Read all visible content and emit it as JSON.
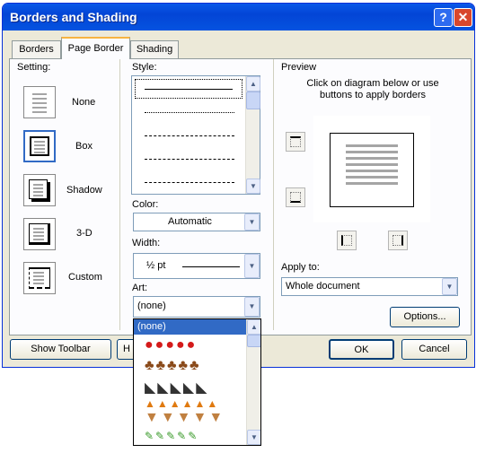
{
  "window": {
    "title": "Borders and Shading",
    "help": "?",
    "close": "✕"
  },
  "tabs": [
    {
      "label": "Borders",
      "underline": "B",
      "selected": false
    },
    {
      "label": "Page Border",
      "underline": "P",
      "selected": true
    },
    {
      "label": "Shading",
      "underline": "S",
      "selected": false
    }
  ],
  "setting": {
    "label": "Setting:",
    "items": [
      {
        "label": "None"
      },
      {
        "label": "Box"
      },
      {
        "label": "Shadow"
      },
      {
        "label": "3-D"
      },
      {
        "label": "Custom"
      }
    ]
  },
  "style": {
    "label": "Style:"
  },
  "color": {
    "label": "Color:",
    "value": "Automatic"
  },
  "width": {
    "label": "Width:",
    "value": "½ pt"
  },
  "art": {
    "label": "Art:",
    "value": "(none)",
    "options": [
      {
        "label": "(none)",
        "selected": true
      },
      {
        "icon": "apple-art-icon"
      },
      {
        "icon": "cupcake-art-icon"
      },
      {
        "icon": "cake-slice-art-icon"
      },
      {
        "icon": "candy-corn-art-icon"
      },
      {
        "icon": "ice-cream-cone-art-icon"
      },
      {
        "icon": "pencil-art-icon"
      }
    ]
  },
  "preview": {
    "label": "Preview",
    "hint": "Click on diagram below or use buttons to apply borders"
  },
  "apply_to": {
    "label": "Apply to:",
    "value": "Whole document"
  },
  "buttons": {
    "options": "Options...",
    "show_toolbar": "Show Toolbar",
    "horizontal_line": "H",
    "ok": "OK",
    "cancel": "Cancel"
  },
  "colors": {
    "title_bar": "#0a58e8",
    "selection": "#316ac5",
    "dialog": "#ece9d8"
  }
}
